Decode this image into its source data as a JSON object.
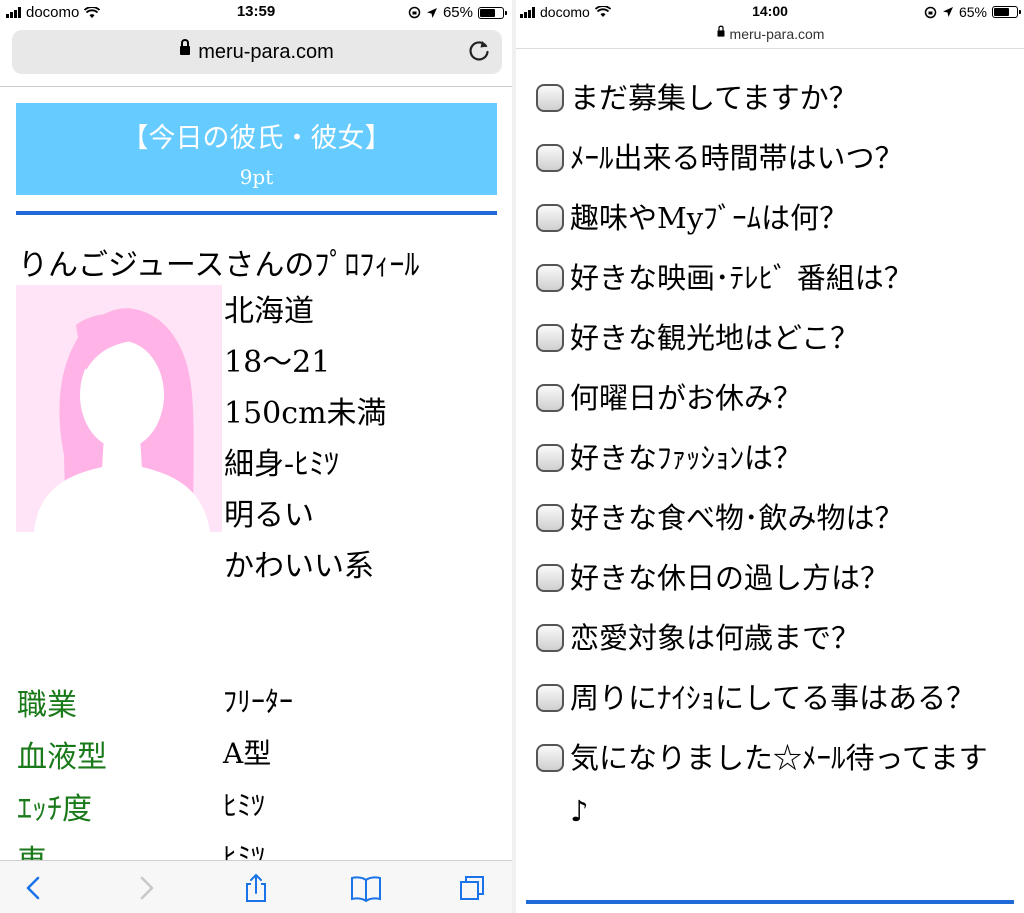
{
  "left": {
    "status": {
      "carrier": "docomo",
      "time": "13:59",
      "battery": "65%"
    },
    "url": "meru-para.com",
    "banner": {
      "title": "【今日の彼氏・彼女】",
      "subtitle": "9pt"
    },
    "profile_title": "りんごジュースさんのﾌﾟﾛﾌｨｰﾙ",
    "attributes": [
      "北海道",
      "18〜21",
      "150cm未満",
      "細身-ﾋﾐﾂ",
      "明るい",
      "かわいい系"
    ],
    "details": [
      {
        "label": "職業",
        "value": "ﾌﾘｰﾀｰ"
      },
      {
        "label": "血液型",
        "value": "A型"
      },
      {
        "label": "ｴｯﾁ度",
        "value": "ﾋﾐﾂ"
      },
      {
        "label": "車",
        "value": "ﾋﾐﾂ"
      }
    ],
    "toolbar_icons": [
      "back-icon",
      "forward-icon",
      "share-icon",
      "bookmarks-icon",
      "tabs-icon"
    ]
  },
  "right": {
    "status": {
      "carrier": "docomo",
      "time": "14:00",
      "battery": "65%"
    },
    "url": "meru-para.com",
    "questions": [
      "まだ募集してますか？",
      "ﾒｰﾙ出来る時間帯はいつ？",
      "趣味やMyﾌﾞｰﾑは何？",
      "好きな映画･ﾃﾚﾋﾞ 番組は？",
      "好きな観光地はどこ？",
      "何曜日がお休み？",
      "好きなﾌｧｯｼｮﾝは？",
      "好きな食べ物･飲み物は？",
      "好きな休日の過し方は？",
      "恋愛対象は何歳まで？",
      "周りにﾅｲｼｮにしてる事はある？",
      "気になりました☆ﾒｰﾙ待ってます♪"
    ]
  },
  "colors": {
    "banner": "#66ccff",
    "accent_blue": "#1f6ad6",
    "label_green": "#1a7a1a",
    "avatar_bg": "#ffe3f6",
    "avatar_fg": "#ffb3e6"
  }
}
